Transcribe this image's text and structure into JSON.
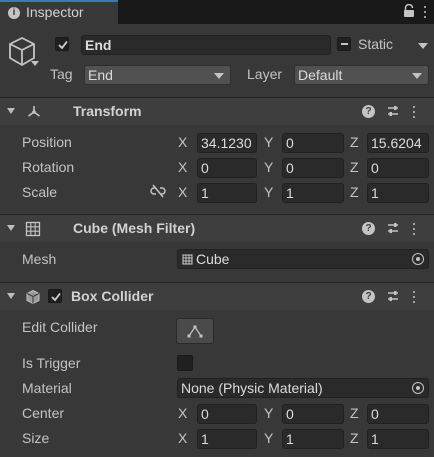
{
  "tab": {
    "title": "Inspector"
  },
  "header": {
    "active": true,
    "name": "End",
    "static_label": "Static",
    "tag_label": "Tag",
    "tag_value": "End",
    "layer_label": "Layer",
    "layer_value": "Default"
  },
  "transform": {
    "title": "Transform",
    "rows": [
      {
        "label": "Position",
        "x": "34.1230",
        "y": "0",
        "z": "15.6204"
      },
      {
        "label": "Rotation",
        "x": "0",
        "y": "0",
        "z": "0"
      },
      {
        "label": "Scale",
        "x": "1",
        "y": "1",
        "z": "1"
      }
    ]
  },
  "mesh_filter": {
    "title": "Cube (Mesh Filter)",
    "mesh_label": "Mesh",
    "mesh_value": "Cube"
  },
  "box_collider": {
    "title": "Box Collider",
    "enabled": true,
    "edit_label": "Edit Collider",
    "trigger_label": "Is Trigger",
    "is_trigger": false,
    "material_label": "Material",
    "material_value": "None (Physic Material)",
    "center_label": "Center",
    "center": {
      "x": "0",
      "y": "0",
      "z": "0"
    },
    "size_label": "Size",
    "size": {
      "x": "1",
      "y": "1",
      "z": "1"
    }
  },
  "axes": {
    "x": "X",
    "y": "Y",
    "z": "Z"
  },
  "colors": {
    "accent": "#3a79bb",
    "background": "#383838",
    "field": "#2a2a2a"
  }
}
